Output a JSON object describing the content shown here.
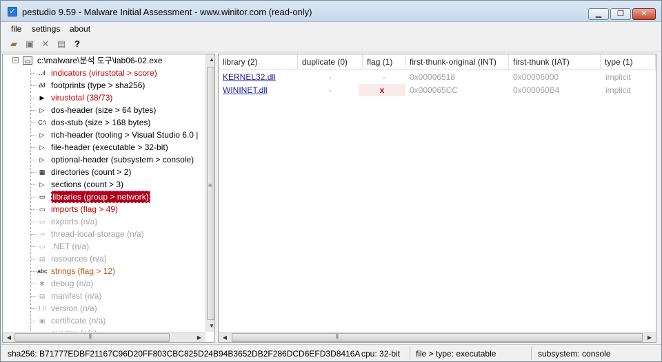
{
  "window": {
    "title": "pestudio 9.59 - Malware Initial Assessment - www.winitor.com (read-only)",
    "controls": {
      "minimize": "▁",
      "maximize": "❐",
      "close": "✕"
    }
  },
  "menu": [
    "file",
    "settings",
    "about"
  ],
  "toolbar": {
    "icons": [
      "open-folder-icon",
      "save-icon",
      "close-file-icon",
      "notes-icon",
      "help-icon"
    ]
  },
  "tree": {
    "root": "c:\\malware\\분석 도구\\lab06-02.exe",
    "items": [
      {
        "label": "indicators (virustotal > score)",
        "style": "red",
        "icon": "chart-icon",
        "glyph": "..ıl"
      },
      {
        "label": "footprints (type > sha256)",
        "style": "normal",
        "icon": "footprints-icon",
        "glyph": "∂∂"
      },
      {
        "label": "virustotal (38/73)",
        "style": "red",
        "icon": "virustotal-icon",
        "glyph": "▶"
      },
      {
        "label": "dos-header (size > 64 bytes)",
        "style": "normal",
        "icon": "expand-icon",
        "glyph": "▷"
      },
      {
        "label": "dos-stub (size > 168 bytes)",
        "style": "normal",
        "icon": "console-icon",
        "glyph": "C:\\"
      },
      {
        "label": "rich-header (tooling > Visual Studio 6.0 |",
        "style": "normal",
        "icon": "expand-icon",
        "glyph": "▷"
      },
      {
        "label": "file-header (executable > 32-bit)",
        "style": "normal",
        "icon": "expand-icon",
        "glyph": "▷"
      },
      {
        "label": "optional-header (subsystem > console)",
        "style": "normal",
        "icon": "expand-icon",
        "glyph": "▷"
      },
      {
        "label": "directories (count > 2)",
        "style": "normal",
        "icon": "directories-icon",
        "glyph": "▦"
      },
      {
        "label": "sections (count > 3)",
        "style": "normal",
        "icon": "expand-icon",
        "glyph": "▷"
      },
      {
        "label": "libraries (group > network)",
        "style": "selected",
        "icon": "libraries-icon",
        "glyph": "▭"
      },
      {
        "label": "imports (flag > 49)",
        "style": "red",
        "icon": "imports-icon",
        "glyph": "▭"
      },
      {
        "label": "exports (n/a)",
        "style": "gray",
        "icon": "exports-icon",
        "glyph": "▭"
      },
      {
        "label": "thread-local-storage (n/a)",
        "style": "gray",
        "icon": "key-icon",
        "glyph": "⊸"
      },
      {
        "label": ".NET (n/a)",
        "style": "gray",
        "icon": "dotnet-icon",
        "glyph": "▭"
      },
      {
        "label": "resources (n/a)",
        "style": "gray",
        "icon": "resources-icon",
        "glyph": "▤"
      },
      {
        "label": "strings (flag > 12)",
        "style": "orange",
        "icon": "strings-icon",
        "glyph": "abc"
      },
      {
        "label": "debug (n/a)",
        "style": "gray",
        "icon": "bug-icon",
        "glyph": "✱"
      },
      {
        "label": "manifest (n/a)",
        "style": "gray",
        "icon": "manifest-icon",
        "glyph": "▤"
      },
      {
        "label": "version (n/a)",
        "style": "gray",
        "icon": "version-icon",
        "glyph": "1.0"
      },
      {
        "label": "certificate (n/a)",
        "style": "gray",
        "icon": "certificate-icon",
        "glyph": "▣"
      },
      {
        "label": "overlay (n/a)",
        "style": "gray",
        "icon": "overlay-icon",
        "glyph": "▭"
      }
    ]
  },
  "table": {
    "columns": [
      "library (2)",
      "duplicate (0)",
      "flag (1)",
      "first-thunk-original (INT)",
      "first-thunk (IAT)",
      "type (1)"
    ],
    "rows": [
      {
        "library": "KERNEL32.dll",
        "duplicate": "-",
        "flag": "-",
        "int": "0x00006518",
        "iat": "0x00006000",
        "type": "implicit"
      },
      {
        "library": "WININET.dll",
        "duplicate": "-",
        "flag": "x",
        "int": "0x000065CC",
        "iat": "0x000060B4",
        "type": "implicit"
      }
    ]
  },
  "status": {
    "sha256": "sha256: B71777EDBF21167C96D20FF803CBC825D24B94B3652DB2F286DCD6EFD3D8416A",
    "cpu": "cpu: 32-bit",
    "file_type": "file > type: executable",
    "subsystem": "subsystem: console"
  },
  "colors": {
    "flag_red": "#c00000",
    "selection_red": "#b0001c",
    "link_blue": "#1a1aa6"
  }
}
